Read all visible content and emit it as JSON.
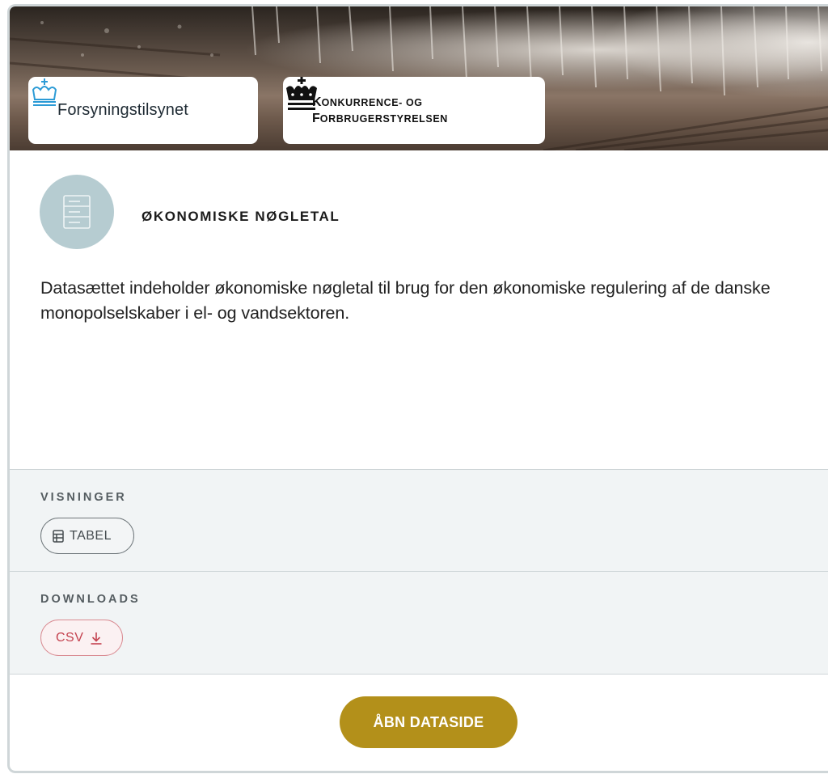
{
  "logos": {
    "forsyningstilsynet": "Forsyningstilsynet",
    "kfst_line1_big": "K",
    "kfst_line1_small": "ONKURRENCE- OG",
    "kfst_line2_big": "F",
    "kfst_line2_small": "ORBRUGERSTYRELSEN"
  },
  "dataset": {
    "icon": "server-stack-icon",
    "title": "ØKONOMISKE NØGLETAL",
    "description": "Datasættet indeholder økonomiske nøgletal til brug for den økonomiske regulering af de danske monopolselskaber i el- og vandsektoren."
  },
  "views": {
    "label": "VISNINGER",
    "items": [
      {
        "label": "TABEL",
        "icon": "table-icon"
      }
    ]
  },
  "downloads": {
    "label": "DOWNLOADS",
    "items": [
      {
        "label": "CSV",
        "icon": "download-icon"
      }
    ]
  },
  "actions": {
    "open_label": "ÅBN DATASIDE"
  },
  "colors": {
    "accent": "#b3901a",
    "icon_circle": "#b6ccd1",
    "csv_accent": "#c4424f",
    "section_bg": "#f1f4f5"
  }
}
